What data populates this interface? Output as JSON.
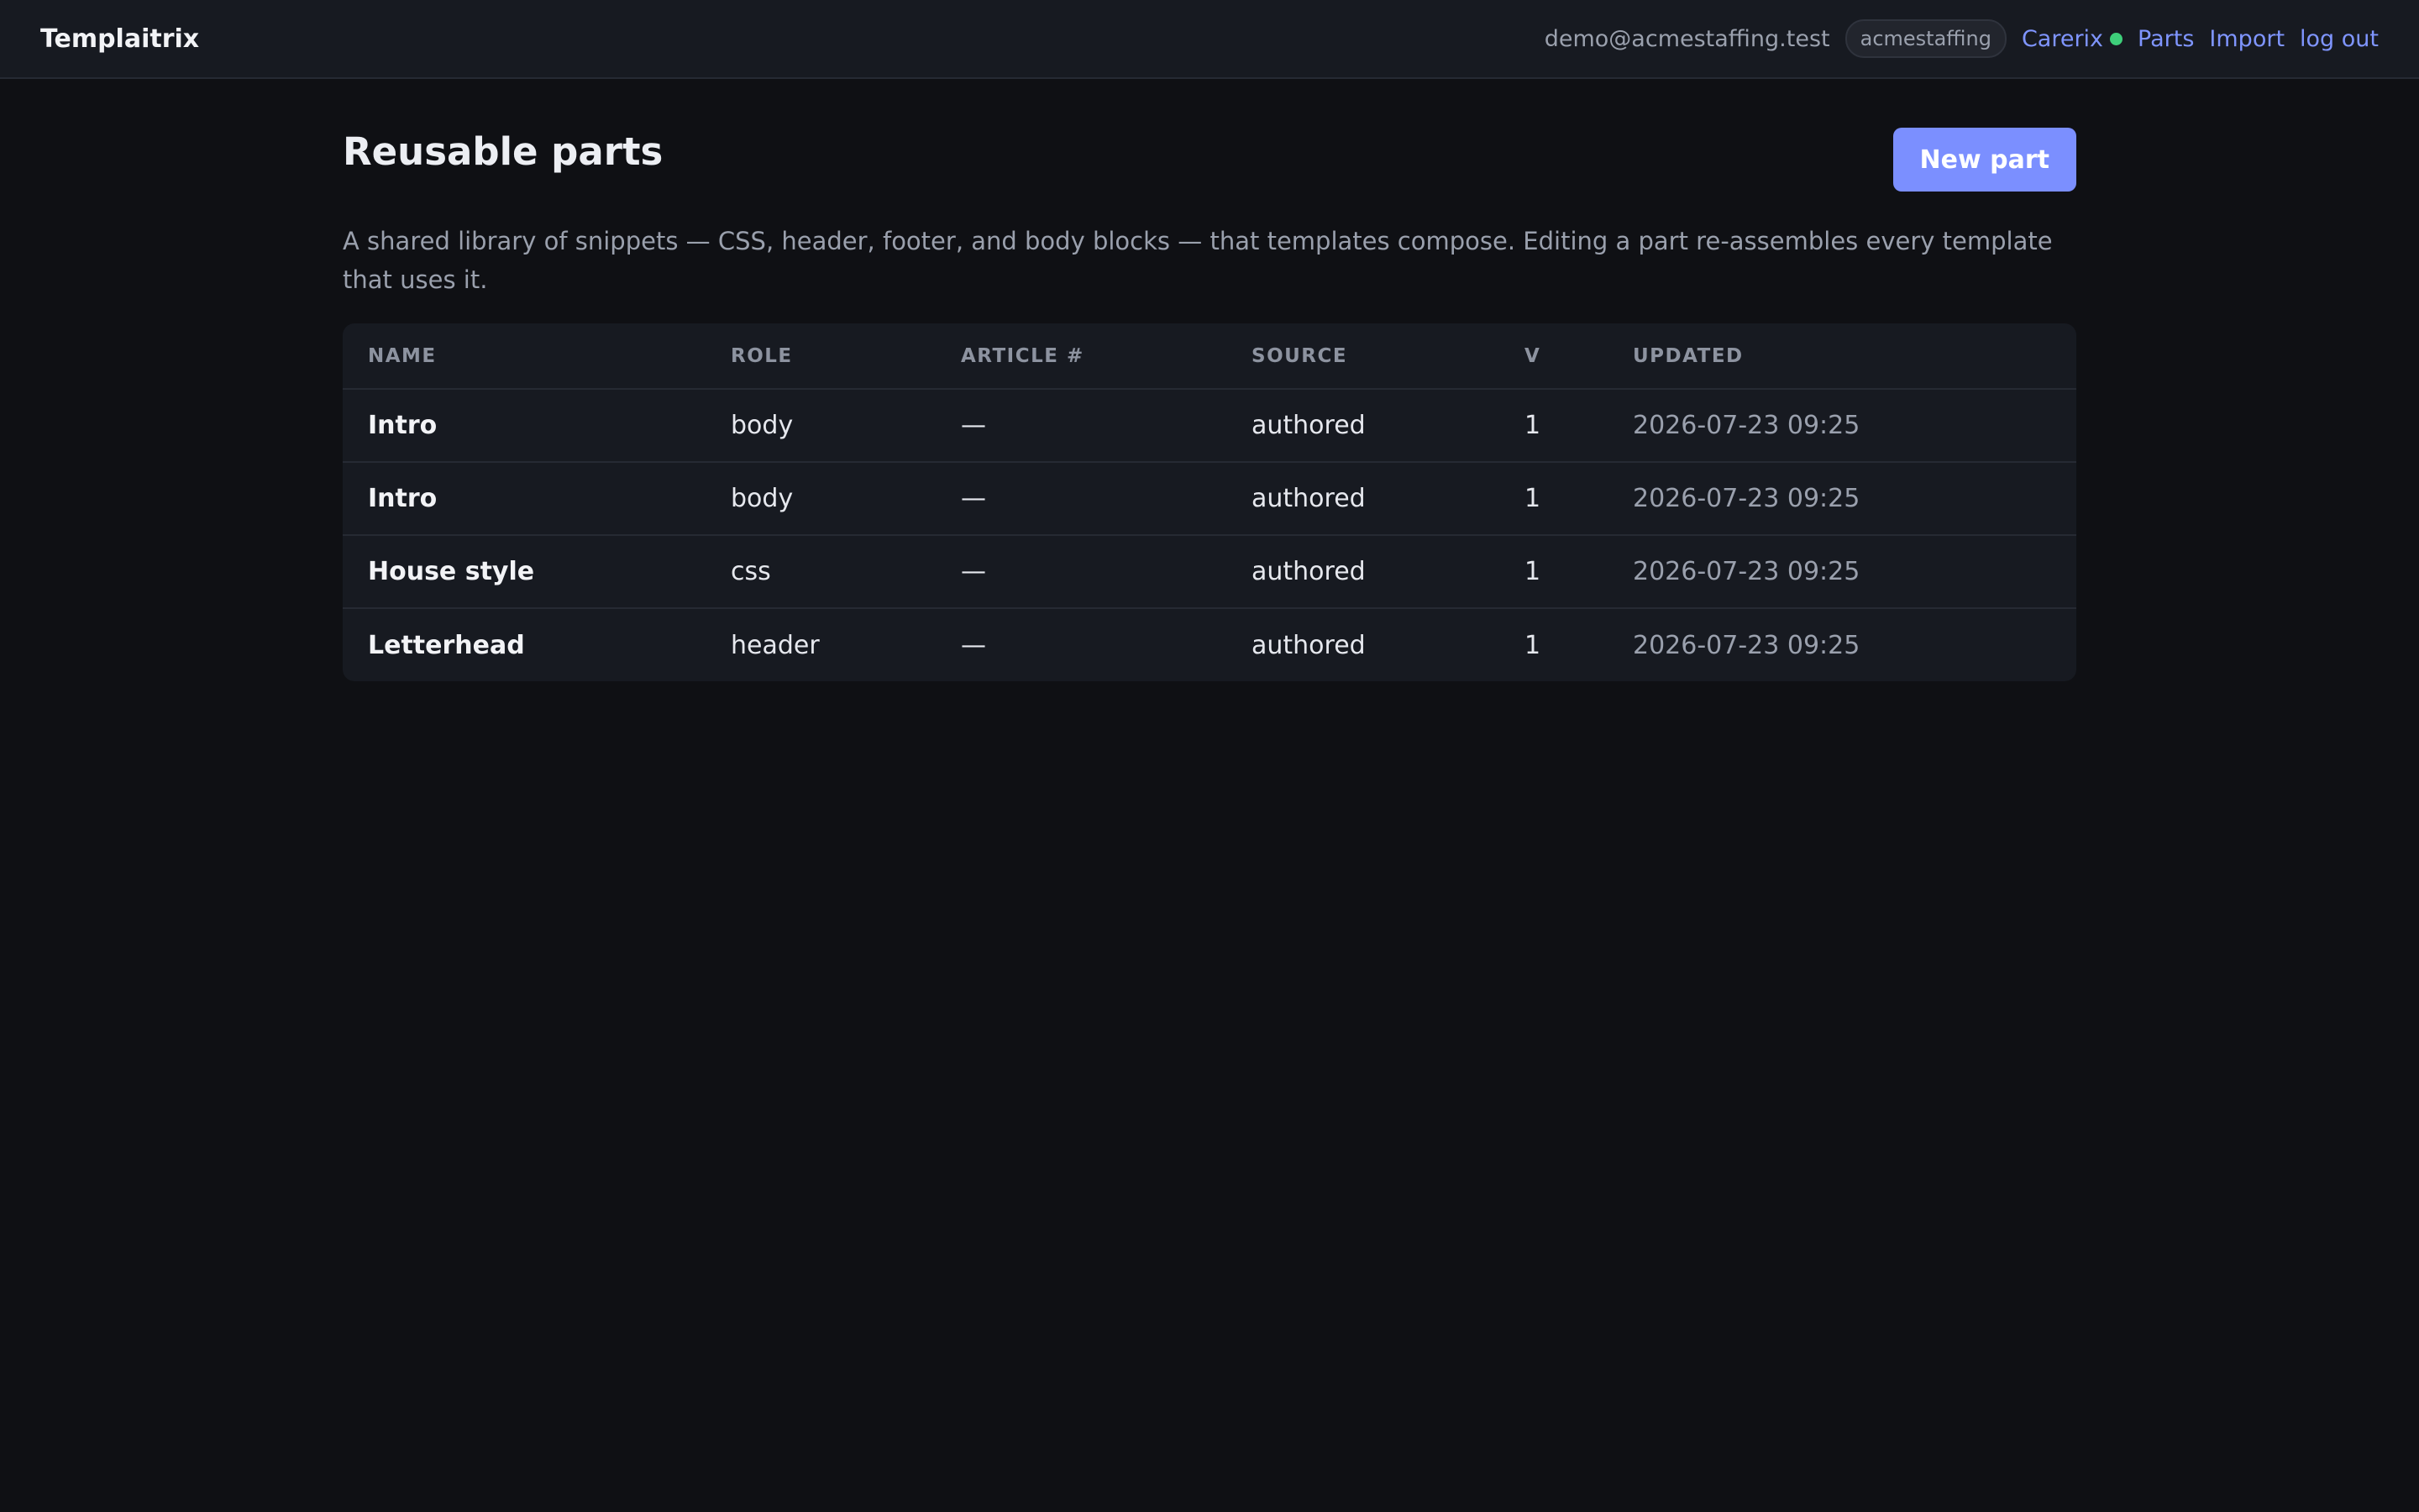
{
  "header": {
    "brand": "Templaitrix",
    "user_email": "demo@acmestaffing.test",
    "org_badge": "acmestaffing",
    "nav": {
      "carerix": "Carerix",
      "parts": "Parts",
      "import": "Import",
      "logout": "log out"
    },
    "status_color": "#3ecf7a"
  },
  "page": {
    "title": "Reusable parts",
    "new_button": "New part",
    "description": "A shared library of snippets — CSS, header, footer, and body blocks — that templates compose. Editing a part re-assembles every template that uses it."
  },
  "table": {
    "columns": [
      "NAME",
      "ROLE",
      "ARTICLE #",
      "SOURCE",
      "V",
      "UPDATED"
    ],
    "rows": [
      {
        "name": "Intro",
        "role": "body",
        "article": "—",
        "source": "authored",
        "version": "1",
        "updated": "2026-07-23 09:25"
      },
      {
        "name": "Intro",
        "role": "body",
        "article": "—",
        "source": "authored",
        "version": "1",
        "updated": "2026-07-23 09:25"
      },
      {
        "name": "House style",
        "role": "css",
        "article": "—",
        "source": "authored",
        "version": "1",
        "updated": "2026-07-23 09:25"
      },
      {
        "name": "Letterhead",
        "role": "header",
        "article": "—",
        "source": "authored",
        "version": "1",
        "updated": "2026-07-23 09:25"
      }
    ]
  },
  "colors": {
    "accent": "#7b8fff",
    "background": "#0f1014",
    "surface": "#171a21"
  }
}
